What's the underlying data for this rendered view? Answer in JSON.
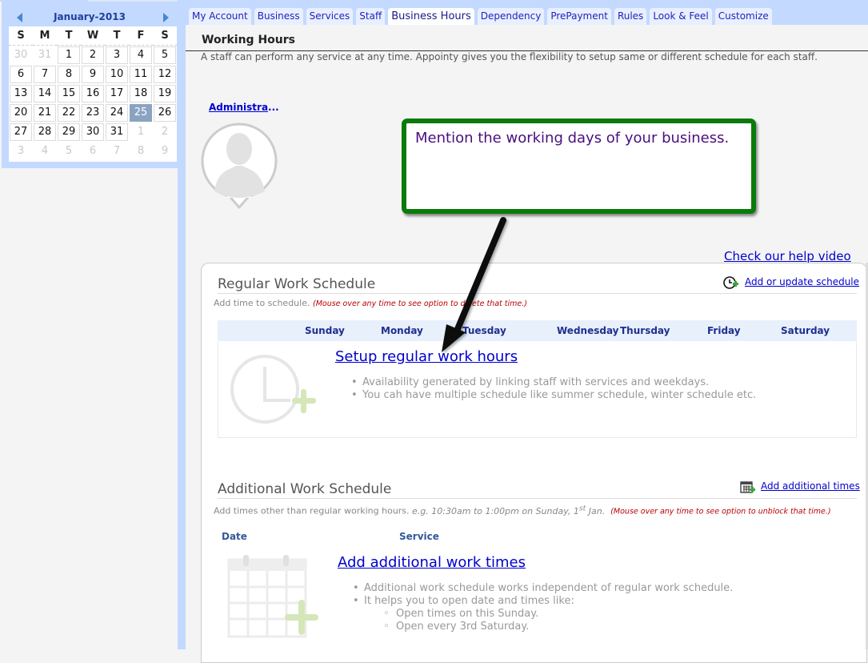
{
  "calendar": {
    "title": "January-2013",
    "prev_icon": "triangle-left-icon",
    "next_icon": "triangle-right-icon",
    "weekdays": [
      "S",
      "M",
      "T",
      "W",
      "T",
      "F",
      "S"
    ],
    "weeks": [
      [
        {
          "d": "30",
          "other": true
        },
        {
          "d": "31",
          "other": true
        },
        {
          "d": "1"
        },
        {
          "d": "2"
        },
        {
          "d": "3"
        },
        {
          "d": "4"
        },
        {
          "d": "5"
        }
      ],
      [
        {
          "d": "6"
        },
        {
          "d": "7"
        },
        {
          "d": "8"
        },
        {
          "d": "9"
        },
        {
          "d": "10"
        },
        {
          "d": "11"
        },
        {
          "d": "12"
        }
      ],
      [
        {
          "d": "13"
        },
        {
          "d": "14"
        },
        {
          "d": "15"
        },
        {
          "d": "16"
        },
        {
          "d": "17"
        },
        {
          "d": "18"
        },
        {
          "d": "19"
        }
      ],
      [
        {
          "d": "20"
        },
        {
          "d": "21"
        },
        {
          "d": "22"
        },
        {
          "d": "23"
        },
        {
          "d": "24"
        },
        {
          "d": "25",
          "today": true
        },
        {
          "d": "26"
        }
      ],
      [
        {
          "d": "27"
        },
        {
          "d": "28"
        },
        {
          "d": "29"
        },
        {
          "d": "30"
        },
        {
          "d": "31"
        },
        {
          "d": "1",
          "other": true
        },
        {
          "d": "2",
          "other": true
        }
      ],
      [
        {
          "d": "3",
          "other": true
        },
        {
          "d": "4",
          "other": true
        },
        {
          "d": "5",
          "other": true
        },
        {
          "d": "6",
          "other": true
        },
        {
          "d": "7",
          "other": true
        },
        {
          "d": "8",
          "other": true
        },
        {
          "d": "9",
          "other": true
        }
      ]
    ],
    "selected_day": "25"
  },
  "tabs": [
    {
      "label": "My Account"
    },
    {
      "label": "Business"
    },
    {
      "label": "Services"
    },
    {
      "label": "Staff"
    },
    {
      "label": "Business Hours",
      "active": true
    },
    {
      "label": "Dependency"
    },
    {
      "label": "PrePayment"
    },
    {
      "label": "Rules"
    },
    {
      "label": "Look & Feel"
    },
    {
      "label": "Customize"
    }
  ],
  "page": {
    "title": "Working Hours",
    "description": "A staff can perform any service at any time. Appointy gives you the flexibility to setup same or different schedule for each staff."
  },
  "staff": {
    "name": "Administra",
    "ellipsis": "...",
    "avatar_icon": "person-silhouette-icon"
  },
  "callout": {
    "text": "Mention the working days of your business."
  },
  "help_link": "Check our help video",
  "regular": {
    "title": "Regular Work Schedule",
    "subtitle": "Add time to schedule.",
    "warning": "(Mouse over any time to see option to delete that time.)",
    "action_label": "Add or update schedule",
    "action_icon": "clock-add-icon",
    "days": [
      "Sunday",
      "Monday",
      "Tuesday",
      "Wednesday",
      "Thursday",
      "Friday",
      "Saturday"
    ],
    "setup_link": "Setup regular work hours",
    "placeholder_icon": "clock-plus-icon",
    "bullets": [
      "Availability generated by linking staff with services and weekdays.",
      "You cah have multiple schedule like summer schedule, winter schedule etc."
    ]
  },
  "additional": {
    "title": "Additional Work Schedule",
    "subtitle": "Add times other than regular working hours.",
    "example_prefix": "e.g. 10:30am to 1:00pm on Sunday, 1",
    "example_sup": "st",
    "example_suffix": " Jan.",
    "warning": "(Mouse over any time to see option to unblock that time.)",
    "action_label": "Add additional times",
    "action_icon": "calendar-add-icon",
    "columns": [
      "Date",
      "Service"
    ],
    "add_link": "Add additional work times",
    "placeholder_icon": "calendar-plus-icon",
    "bullets": [
      "Additional work schedule works independent of regular work schedule.",
      "It helps you to open date and times like:"
    ],
    "sub_bullets": [
      "Open times on this Sunday.",
      "Open every 3rd Saturday."
    ]
  },
  "colors": {
    "frame": "#c3d9ff",
    "callout_border": "#0a7b0a",
    "callout_text": "#4b0f7e",
    "link": "#0000cc",
    "warning": "#bb0000",
    "today_bg": "#8aa3c1"
  }
}
